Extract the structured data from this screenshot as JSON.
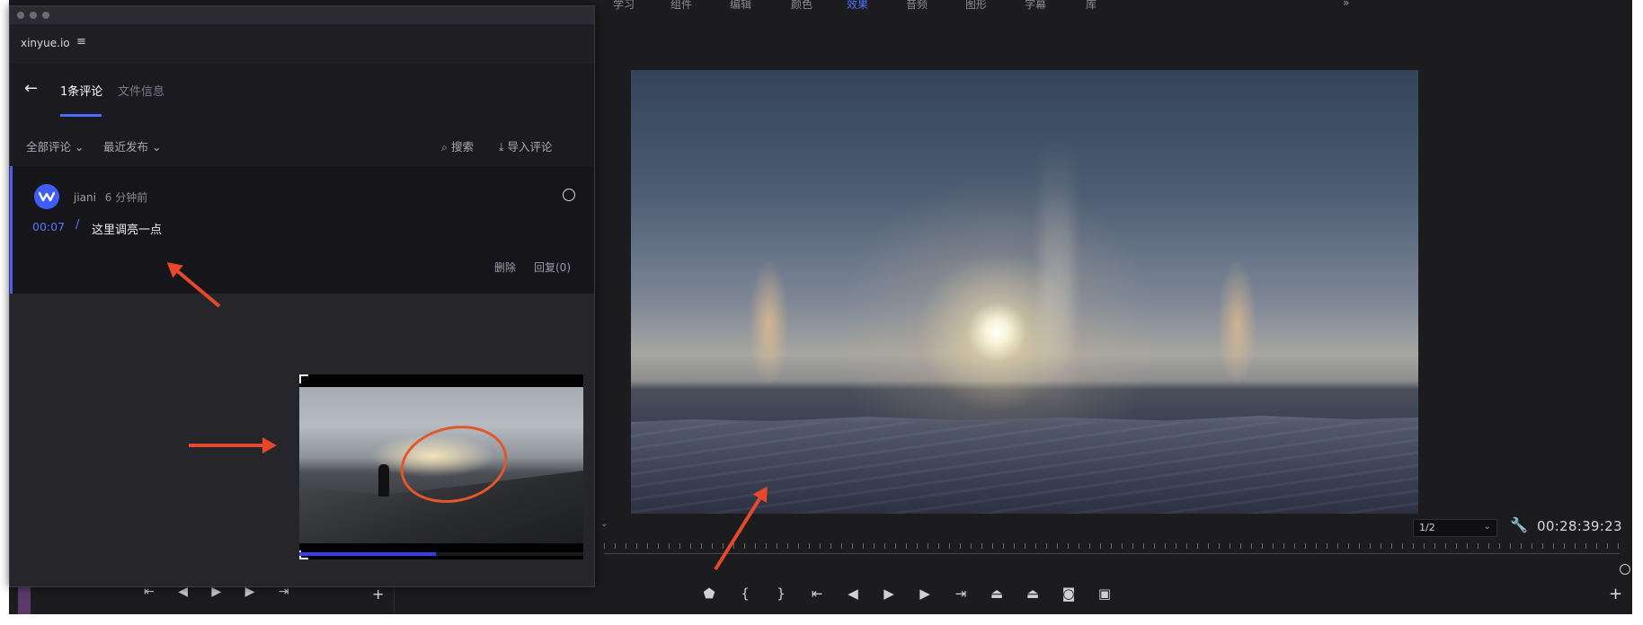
{
  "top_menu": {
    "items": [
      "学习",
      "组件",
      "编辑",
      "颜色",
      "效果",
      "音频",
      "图形",
      "字幕",
      "库"
    ],
    "active_index": 4,
    "more_label": "»"
  },
  "panel": {
    "brand": "xinyue.io",
    "menu_icon": "hamburger-icon",
    "tabs": [
      {
        "label": "1条评论",
        "active": true
      },
      {
        "label": "文件信息",
        "active": false
      }
    ],
    "filters": {
      "all_comments": "全部评论",
      "sort": "最近发布",
      "search": "搜索",
      "import": "导入评论"
    },
    "comment": {
      "author": "jiani",
      "time_ago": "6 分钟前",
      "timecode": "00:07",
      "text": "这里调亮一点",
      "delete_label": "删除",
      "reply_label": "回复(0)"
    },
    "thumbnail": {
      "progress_fraction": 0.48
    }
  },
  "monitor": {
    "resolution": "1/2",
    "timecode": "00:28:39:23"
  },
  "colors": {
    "accent": "#4b6bff",
    "annotation": "#e5482b",
    "panel_bg": "#25252a"
  }
}
